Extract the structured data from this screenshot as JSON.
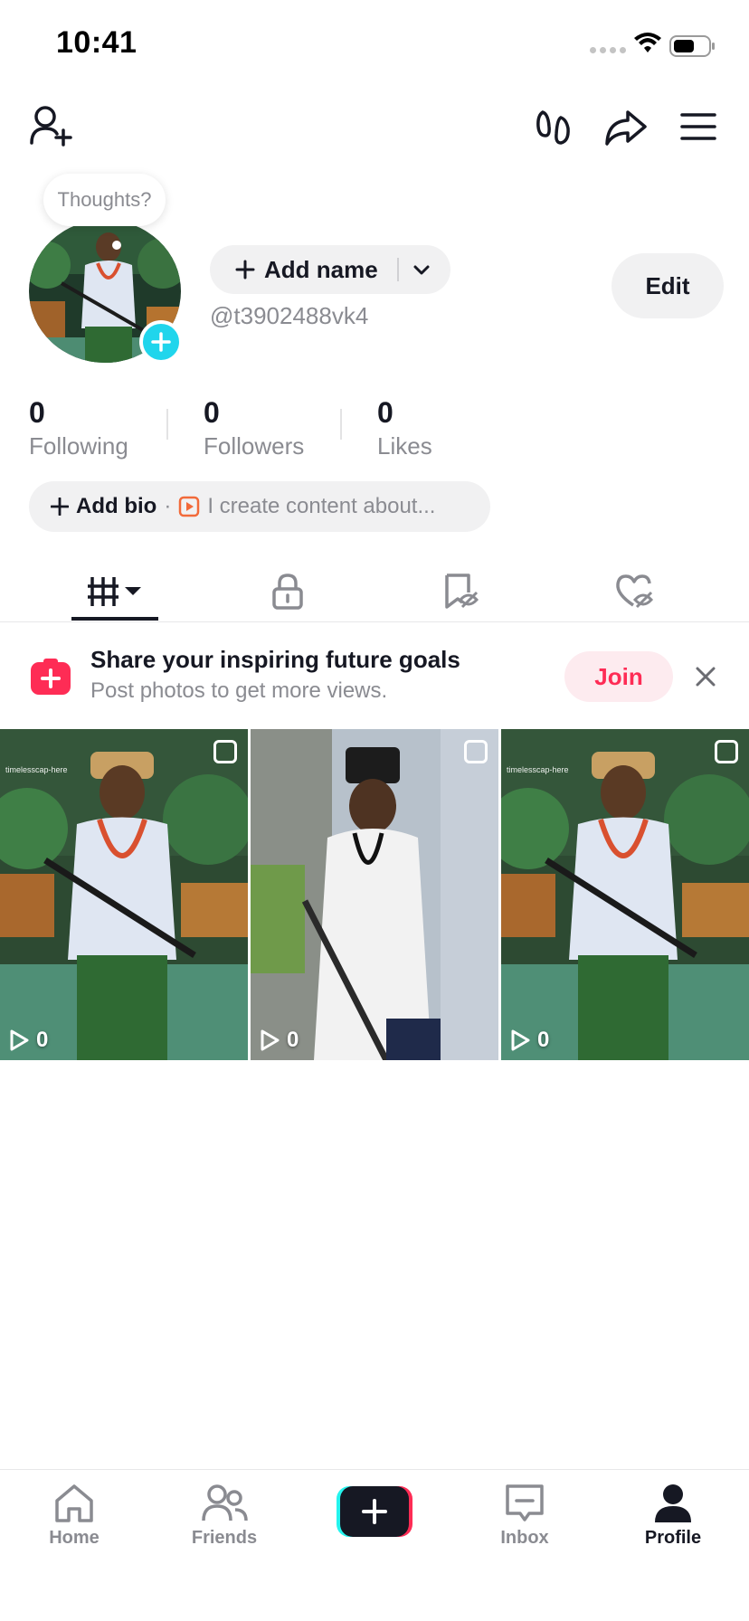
{
  "status": {
    "time": "10:41"
  },
  "profile": {
    "thoughts_placeholder": "Thoughts?",
    "add_name_label": "Add name",
    "username": "@t3902488vk4",
    "edit_label": "Edit"
  },
  "stats": [
    {
      "value": "0",
      "label": "Following"
    },
    {
      "value": "0",
      "label": "Followers"
    },
    {
      "value": "0",
      "label": "Likes"
    }
  ],
  "bio": {
    "add_label": "Add bio",
    "separator": "·",
    "placeholder": "I create content about..."
  },
  "tabs": [
    {
      "icon": "grid-icon",
      "active": true
    },
    {
      "icon": "lock-icon",
      "active": false
    },
    {
      "icon": "hidden-bookmark-icon",
      "active": false
    },
    {
      "icon": "hidden-heart-icon",
      "active": false
    }
  ],
  "promo": {
    "title": "Share your inspiring future goals",
    "subtitle": "Post photos to get more views.",
    "join_label": "Join"
  },
  "posts": [
    {
      "views": "0",
      "watermark": "timelesscap-here"
    },
    {
      "views": "0",
      "watermark": ""
    },
    {
      "views": "0",
      "watermark": "timelesscap-here"
    }
  ],
  "nav": {
    "home": "Home",
    "friends": "Friends",
    "inbox": "Inbox",
    "profile": "Profile"
  },
  "colors": {
    "accent_red": "#fe2c55",
    "accent_cyan": "#20d5ec",
    "text_primary": "#161823",
    "text_secondary": "#8a8b91"
  }
}
